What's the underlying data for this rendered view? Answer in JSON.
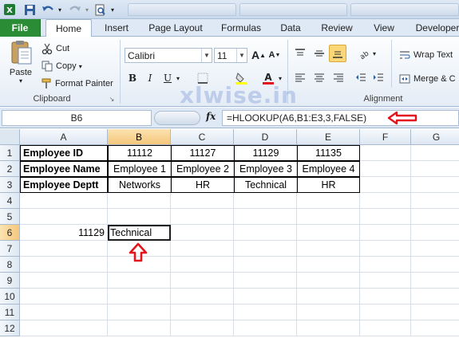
{
  "ribbon_tabs": {
    "file": "File",
    "home": "Home",
    "insert": "Insert",
    "page_layout": "Page Layout",
    "formulas": "Formulas",
    "data": "Data",
    "review": "Review",
    "view": "View",
    "developer": "Developer"
  },
  "clipboard": {
    "paste": "Paste",
    "cut": "Cut",
    "copy": "Copy",
    "format_painter": "Format Painter",
    "group_label": "Clipboard"
  },
  "font": {
    "name": "Calibri",
    "size": "11"
  },
  "alignment": {
    "wrap_text": "Wrap Text",
    "merge": "Merge & C",
    "group_label": "Alignment"
  },
  "formula_bar": {
    "name_box": "B6",
    "fx": "fx",
    "formula": "=HLOOKUP(A6,B1:E3,3,FALSE)"
  },
  "watermark": "xlwise.in",
  "columns": [
    "A",
    "B",
    "C",
    "D",
    "E",
    "F",
    "G"
  ],
  "rows": [
    "1",
    "2",
    "3",
    "4",
    "5",
    "6",
    "7",
    "8",
    "9",
    "10",
    "11",
    "12"
  ],
  "cells": {
    "A1": "Employee ID",
    "B1": "11112",
    "C1": "11127",
    "D1": "11129",
    "E1": "11135",
    "A2": "Employee Name",
    "B2": "Employee 1",
    "C2": "Employee 2",
    "D2": "Employee 3",
    "E2": "Employee 4",
    "A3": "Employee Deptt",
    "B3": "Networks",
    "C3": "HR",
    "D3": "Technical",
    "E3": "HR",
    "A6": "11129",
    "B6": "Technical"
  },
  "colors": {
    "file_tab": "#2a8d36",
    "arrow": "#e3141b",
    "ribbon_bg": "#dfe9f5"
  }
}
